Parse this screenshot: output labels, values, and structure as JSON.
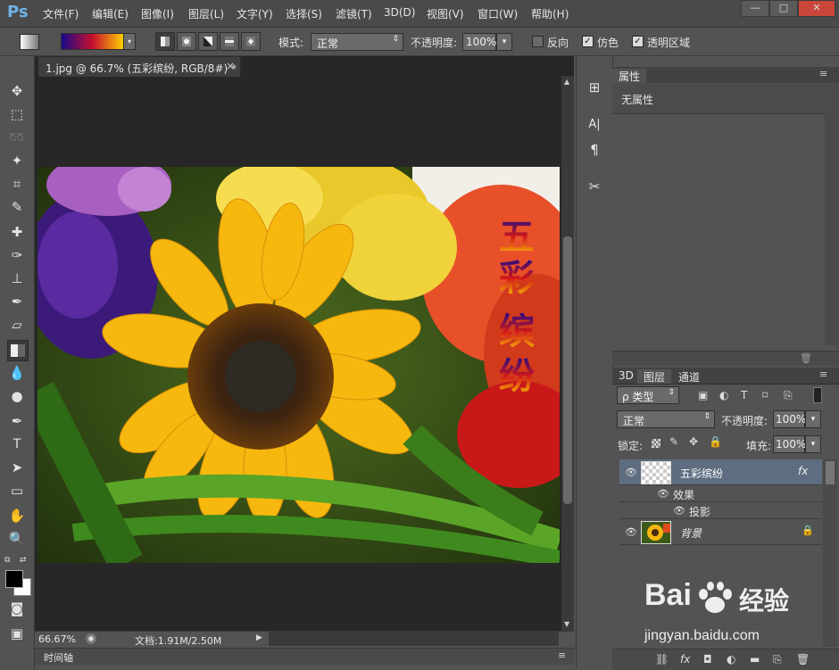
{
  "app": {
    "logo": "Ps"
  },
  "menu": [
    "文件(F)",
    "编辑(E)",
    "图像(I)",
    "图层(L)",
    "文字(Y)",
    "选择(S)",
    "滤镜(T)",
    "3D(D)",
    "视图(V)",
    "窗口(W)",
    "帮助(H)"
  ],
  "window_controls": {
    "minimize": "—",
    "maximize": "□",
    "close": "✕"
  },
  "options": {
    "mode_label": "模式:",
    "mode_value": "正常",
    "opacity_label": "不透明度:",
    "opacity_value": "100%",
    "reverse_label": "反向",
    "dither_label": "仿色",
    "transparency_label": "透明区域",
    "gradient_colors": [
      "#1a0a8a",
      "#c8102e",
      "#ffd400"
    ]
  },
  "document": {
    "tab_title": "1.jpg @ 66.7% (五彩缤纷, RGB/8#) *",
    "tab_close": "×",
    "canvas_text": [
      "五",
      "彩",
      "缤",
      "纷"
    ],
    "zoom": "66.67%",
    "doc_size": "文档:1.91M/2.50M",
    "timeline_label": "时间轴"
  },
  "properties": {
    "tab": "属性",
    "content": "无属性"
  },
  "layers_panel": {
    "tabs": [
      "3D",
      "图层",
      "通道"
    ],
    "filter_label": "ρ 类型",
    "blend_mode": "正常",
    "opacity_label": "不透明度:",
    "opacity_value": "100%",
    "lock_label": "锁定:",
    "fill_label": "填充:",
    "fill_value": "100%",
    "layers": [
      {
        "name": "五彩缤纷",
        "fx": "fx",
        "effects_label": "效果",
        "effect": "投影"
      },
      {
        "name": "背景"
      }
    ]
  },
  "watermark": {
    "brand": "Bai",
    "brand_tail": "经验",
    "url": "jingyan.baidu.com"
  },
  "colors": {
    "accent_blue": "#6fb2e6",
    "selected_row": "#5e6d80"
  }
}
